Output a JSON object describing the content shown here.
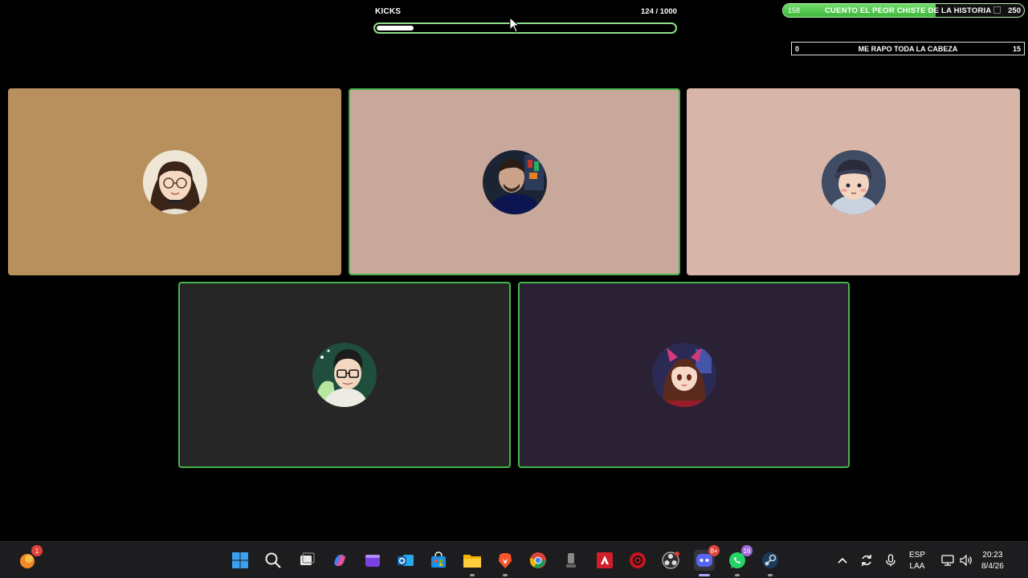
{
  "kicks": {
    "label": "KICKS",
    "count_text": "124 / 1000",
    "current": 124,
    "max": 1000
  },
  "goal": {
    "current": "158",
    "title": "CUENTO EL PEOR CHISTE DE LA HISTORIA",
    "max": "250",
    "progress": 0.632
  },
  "counter": {
    "left": "0",
    "title": "ME RAPO TODA LA CABEZA",
    "right": "15"
  },
  "participants": [
    {
      "avatar": "avatar-woman-glasses",
      "bg": "#b8905e",
      "speaking": false
    },
    {
      "avatar": "avatar-man-photo",
      "bg": "#c9a89c",
      "speaking": true
    },
    {
      "avatar": "avatar-boy-cap",
      "bg": "#d7b5a8",
      "speaking": false
    },
    {
      "avatar": "avatar-man-glasses",
      "bg": "#262626",
      "speaking": true
    },
    {
      "avatar": "avatar-girl-cat-ears",
      "bg": "#2a2234",
      "speaking": true
    }
  ],
  "taskbar": {
    "apps": [
      "windows-start-icon",
      "search-icon",
      "task-view-icon",
      "copilot-icon",
      "clipchamp-icon",
      "outlook-icon",
      "store-icon",
      "file-explorer-icon",
      "brave-icon",
      "chrome-icon",
      "microphone-app-icon",
      "amd-icon",
      "antivirus-icon",
      "obs-icon",
      "discord-icon",
      "whatsapp-icon",
      "steam-icon"
    ],
    "discord_badge": "8+",
    "whatsapp_badge": "16",
    "widget_badge": "1",
    "language_top": "ESP",
    "language_bottom": "LAA",
    "time": "20:23",
    "date": "8/4/26"
  }
}
